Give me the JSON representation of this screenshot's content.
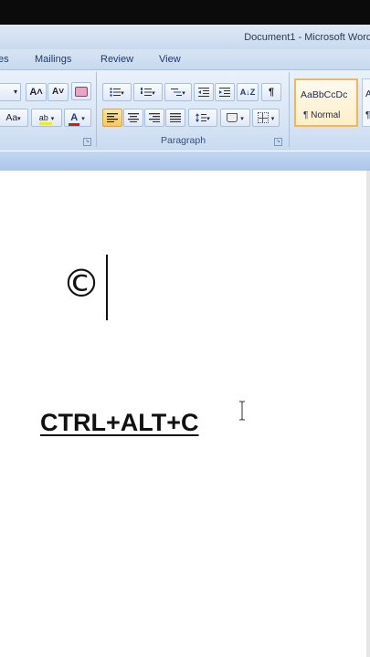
{
  "window": {
    "title": "Document1 - Microsoft Word"
  },
  "ribbon": {
    "tabs": [
      {
        "label": "es"
      },
      {
        "label": "Mailings"
      },
      {
        "label": "Review"
      },
      {
        "label": "View"
      }
    ],
    "font_group": {
      "grow_font": "A˄",
      "shrink_font": "A˅",
      "change_case": "Aa",
      "highlight": "ab",
      "font_color": "A"
    },
    "paragraph_group": {
      "label": "Paragraph",
      "show_hide": "¶",
      "sort": "A↓Z",
      "active_alignment": "align-left"
    },
    "styles": [
      {
        "sample": "AaBbCcDc",
        "name": "¶ Normal"
      },
      {
        "sample": "A",
        "name": "¶"
      }
    ]
  },
  "document": {
    "symbol": "©",
    "shortcut_text": "CTRL+ALT+C"
  },
  "colors": {
    "accent_highlight": "#f7c75a",
    "font_color_red": "#d11a1a",
    "highlight_yellow": "#f5e826",
    "ribbon_blue": "#c9dbf0"
  }
}
